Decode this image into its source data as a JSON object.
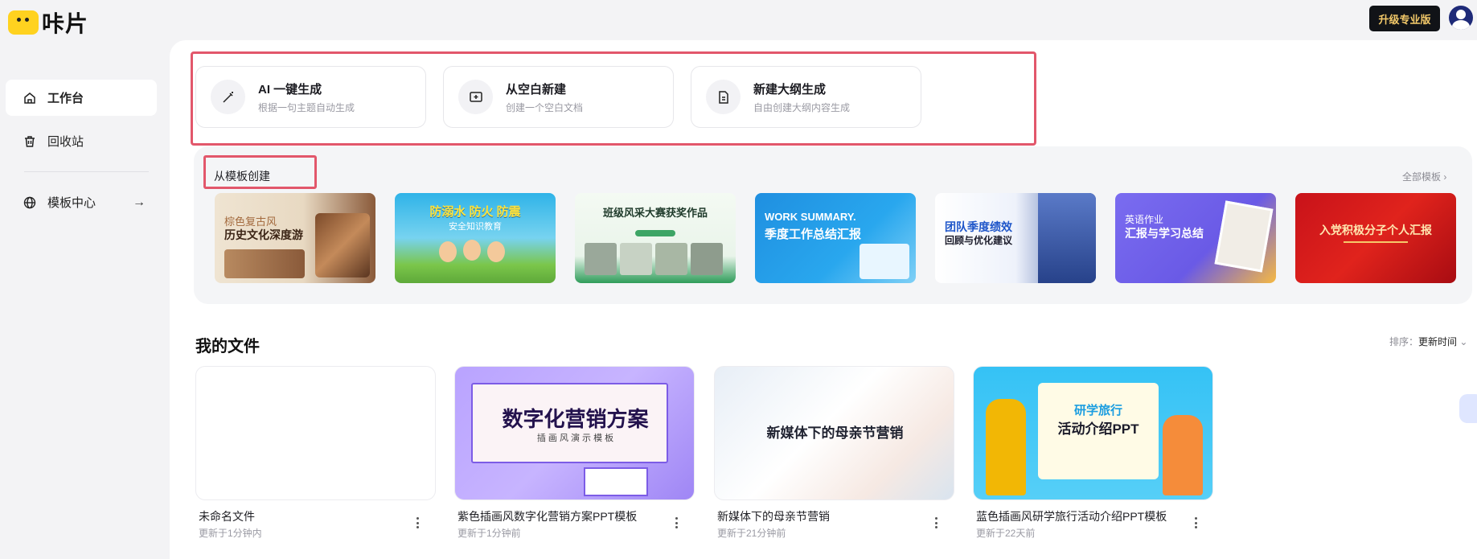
{
  "app": {
    "logo_text": "咔片"
  },
  "header": {
    "upgrade_label": "升级专业版"
  },
  "sidebar": {
    "items": [
      {
        "label": "工作台",
        "icon": "home-icon"
      },
      {
        "label": "回收站",
        "icon": "trash-icon"
      },
      {
        "label": "模板中心",
        "icon": "globe-icon"
      }
    ]
  },
  "quick_create": [
    {
      "title": "AI 一键生成",
      "subtitle": "根据一句主题自动生成",
      "icon": "magic-wand-icon"
    },
    {
      "title": "从空白新建",
      "subtitle": "创建一个空白文档",
      "icon": "add-slide-icon"
    },
    {
      "title": "新建大纲生成",
      "subtitle": "自由创建大纲内容生成",
      "icon": "document-icon"
    }
  ],
  "templates": {
    "section_label": "从模板创建",
    "all_label": "全部模板 ›",
    "items": [
      {
        "line1": "棕色复古风",
        "line2": "历史文化深度游"
      },
      {
        "line1": "防溺水 防火 防震",
        "line2": "安全知识教育"
      },
      {
        "line1": "班级风采大赛获奖作品",
        "line2": ""
      },
      {
        "line1": "WORK SUMMARY.",
        "line2": "季度工作总结汇报"
      },
      {
        "line1": "团队季度绩效",
        "line2": "回顾与优化建议"
      },
      {
        "line1": "英语作业",
        "line2": "汇报与学习总结"
      },
      {
        "line1": "入党积极分子个人汇报",
        "line2": ""
      }
    ]
  },
  "files": {
    "title": "我的文件",
    "sort_prefix": "排序：",
    "sort_value": "更新时间",
    "items": [
      {
        "name": "未命名文件",
        "updated": "更新于1分钟内",
        "thumb_title": "",
        "thumb_sub": ""
      },
      {
        "name": "紫色插画风数字化营销方案PPT模板",
        "updated": "更新于1分钟前",
        "thumb_title": "数字化营销方案",
        "thumb_sub": "插 画 风 演 示 模 板"
      },
      {
        "name": "新媒体下的母亲节营销",
        "updated": "更新于21分钟前",
        "thumb_title": "新媒体下的母亲节营销",
        "thumb_sub": ""
      },
      {
        "name": "蓝色插画风研学旅行活动介绍PPT模板",
        "updated": "更新于22天前",
        "thumb_title": "研学旅行",
        "thumb_sub": "活动介绍PPT"
      }
    ]
  }
}
